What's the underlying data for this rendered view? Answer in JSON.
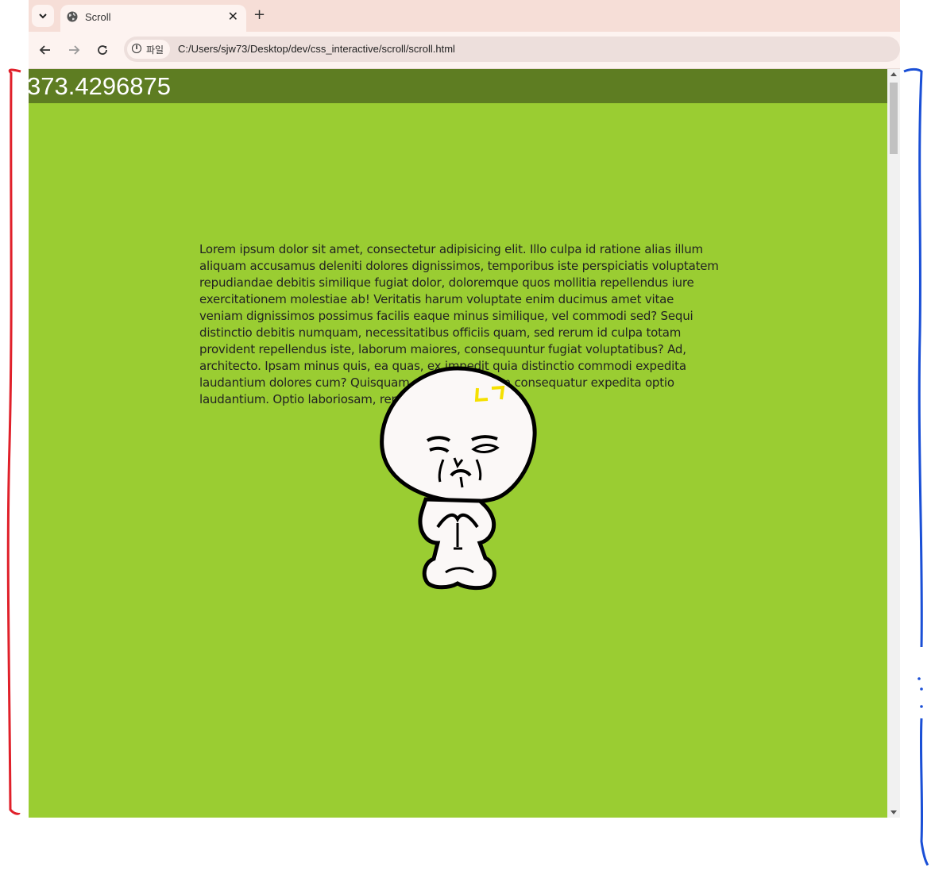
{
  "browser": {
    "tab_title": "Scroll",
    "new_tab_symbol": "+",
    "close_symbol": "✕",
    "site_chip_label": "파일",
    "url": "C:/Users/sjw73/Desktop/dev/css_interactive/scroll/scroll.html"
  },
  "page": {
    "scroll_value": "373.4296875",
    "paragraph": "Lorem ipsum dolor sit amet, consectetur adipisicing elit. Illo culpa id ratione alias illum aliquam accusamus deleniti dolores dignissimos, temporibus iste perspiciatis voluptatem repudiandae debitis similique fugiat dolor, doloremque quos mollitia repellendus iure exercitationem molestiae ab! Veritatis harum voluptate enim ducimus amet vitae veniam dignissimos possimus facilis eaque minus similique, vel commodi sed? Sequi distinctio debitis numquam, necessitatibus officiis quam, sed rerum id culpa totam provident repellendus iste, laborum maiores, consequuntur fugiat voluptatibus? Ad, architecto. Ipsam minus quis, ea quas, ex impedit quia distinctio commodi expedita laudantium dolores cum? Quisquam, odit, laboriosam consequatur expedita optio laudantium. Optio laboriosam, repellendus laborum.",
    "character_badge": "ㄴㄱ"
  },
  "colors": {
    "page_background": "#9acd32",
    "topbar": "#5e7d22",
    "tabstrip": "#f6ded7",
    "annotation_left": "#e0202a",
    "annotation_right": "#1a4fd6"
  }
}
